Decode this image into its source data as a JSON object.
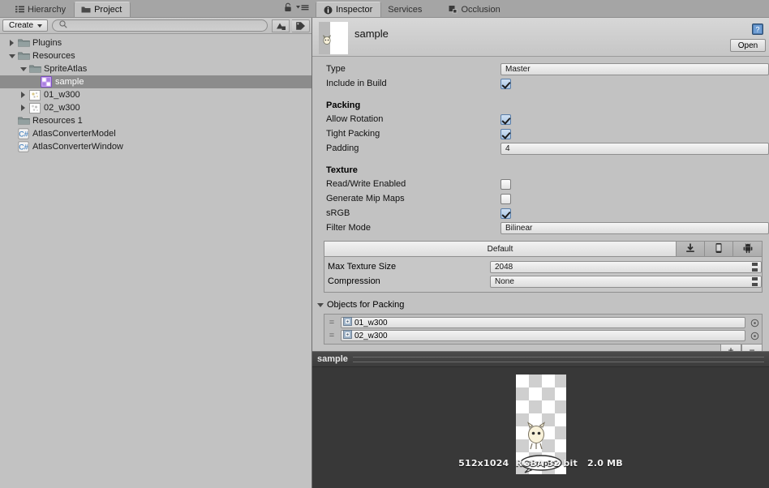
{
  "project_panel": {
    "tabs": [
      {
        "label": "Hierarchy",
        "icon": "hierarchy-icon",
        "active": false
      },
      {
        "label": "Project",
        "icon": "folder-icon",
        "active": true
      }
    ],
    "lock_icon": "lock-icon",
    "menu_icon": "hamburger-menu-icon",
    "toolbar": {
      "create_label": "Create",
      "search_value": "",
      "search_placeholder": "",
      "search_icon": "search-icon",
      "filter_type_icon": "filter-by-type-icon",
      "filter_label_icon": "filter-by-label-icon"
    },
    "tree": [
      {
        "label": "Plugins",
        "indent": 0,
        "twisty": "right",
        "icon": "folder-icon",
        "selected": false
      },
      {
        "label": "Resources",
        "indent": 0,
        "twisty": "down",
        "icon": "folder-icon",
        "selected": false
      },
      {
        "label": "SpriteAtlas",
        "indent": 1,
        "twisty": "down",
        "icon": "folder-icon",
        "selected": false
      },
      {
        "label": "sample",
        "indent": 2,
        "twisty": "none",
        "icon": "sprite-atlas-icon",
        "selected": true
      },
      {
        "label": "01_w300",
        "indent": 1,
        "twisty": "right",
        "icon": "texture-icon",
        "selected": false
      },
      {
        "label": "02_w300",
        "indent": 1,
        "twisty": "right",
        "icon": "texture-icon",
        "selected": false
      },
      {
        "label": "Resources 1",
        "indent": 0,
        "twisty": "none",
        "icon": "folder-icon",
        "selected": false
      },
      {
        "label": "AtlasConverterModel",
        "indent": 0,
        "twisty": "none",
        "icon": "csharp-script-icon",
        "selected": false
      },
      {
        "label": "AtlasConverterWindow",
        "indent": 0,
        "twisty": "none",
        "icon": "csharp-script-icon",
        "selected": false
      }
    ]
  },
  "inspector": {
    "tabs": [
      {
        "label": "Inspector",
        "icon": "info-circle-icon",
        "active": true
      },
      {
        "label": "Services",
        "icon": "none",
        "active": false
      },
      {
        "label": "Occlusion",
        "icon": "occlusion-icon",
        "active": false
      }
    ],
    "asset": {
      "name": "sample",
      "help_icon": "help-book-icon",
      "open_button": "Open"
    },
    "type_row": {
      "label": "Type",
      "value": "Master"
    },
    "include_row": {
      "label": "Include in Build",
      "checked": true
    },
    "packing": {
      "header": "Packing",
      "allow_rotation": {
        "label": "Allow Rotation",
        "checked": true
      },
      "tight_packing": {
        "label": "Tight Packing",
        "checked": true
      },
      "padding": {
        "label": "Padding",
        "value": "4"
      }
    },
    "texture": {
      "header": "Texture",
      "read_write": {
        "label": "Read/Write Enabled",
        "checked": false
      },
      "mipmaps": {
        "label": "Generate Mip Maps",
        "checked": false
      },
      "srgb": {
        "label": "sRGB",
        "checked": true
      },
      "filter_mode": {
        "label": "Filter Mode",
        "value": "Bilinear"
      }
    },
    "platform": {
      "tabs": [
        {
          "label": "Default",
          "icon": "none",
          "active": true
        },
        {
          "label": "",
          "icon": "standalone-download-icon",
          "active": false
        },
        {
          "label": "",
          "icon": "ios-device-icon",
          "active": false
        },
        {
          "label": "",
          "icon": "android-robot-icon",
          "active": false
        }
      ],
      "max_texture_size": {
        "label": "Max Texture Size",
        "value": "2048"
      },
      "compression": {
        "label": "Compression",
        "value": "None"
      }
    },
    "objects_for_packing": {
      "header": "Objects for Packing",
      "foldout_icon": "triangle-down-icon",
      "items": [
        {
          "name": "01_w300",
          "icon": "texture-small-icon",
          "picker_icon": "object-picker-icon"
        },
        {
          "name": "02_w300",
          "icon": "texture-small-icon",
          "picker_icon": "object-picker-icon"
        }
      ],
      "add_label": "+",
      "remove_label": "−"
    },
    "preview": {
      "title": "sample",
      "stats": "512x1024  RGBA 32 bit   2.0 MB"
    }
  }
}
